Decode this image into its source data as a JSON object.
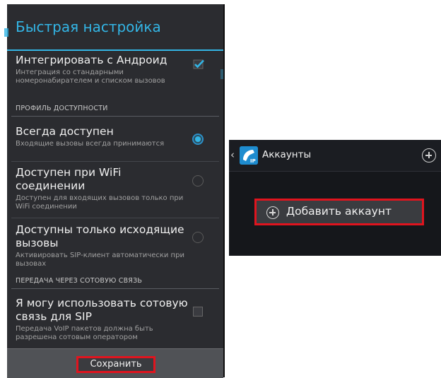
{
  "left_screen": {
    "title": "Быстрая настройка",
    "items": [
      {
        "title": "Интегрировать с Андроид",
        "summary": "Интеграция со стандарными номеронабирателем и списком вызовов",
        "control": "checkbox",
        "checked": true
      },
      {
        "title": "Всегда доступен",
        "summary": "Входящие вызовы всегда принимаются",
        "control": "radio",
        "checked": true
      },
      {
        "title": "Доступен при WiFi соединении",
        "summary": "Доступен для входящих вызовов только при WiFi соединении",
        "control": "radio",
        "checked": false
      },
      {
        "title": "Доступны только исходящие вызовы",
        "summary": "Активировать SIP-клиент автоматически при вызовах",
        "control": "radio",
        "checked": false
      },
      {
        "title": "Я могу использовать сотовую связь для SIP",
        "summary": "Передача VoIP пакетов должна быть разрешена сотовым оператором",
        "control": "checkbox",
        "checked": false
      }
    ],
    "sections": {
      "availability": "ПРОФИЛЬ ДОСТУПНОСТИ",
      "cellular": "ПЕРЕДАЧА ЧЕРЕЗ СОТОВУЮ СВЯЗЬ"
    },
    "save_label": "Сохранить"
  },
  "right_screen": {
    "title": "Аккаунты",
    "app_icon_text": "IP",
    "add_account_label": "Добавить аккаунт"
  },
  "colors": {
    "accent": "#33b5e5",
    "highlight": "#e0141e",
    "dialog_bg": "#2b2c30"
  },
  "icons": [
    "check-icon",
    "radio-icon",
    "back-chevron-icon",
    "app-icon",
    "add-circle-icon"
  ]
}
